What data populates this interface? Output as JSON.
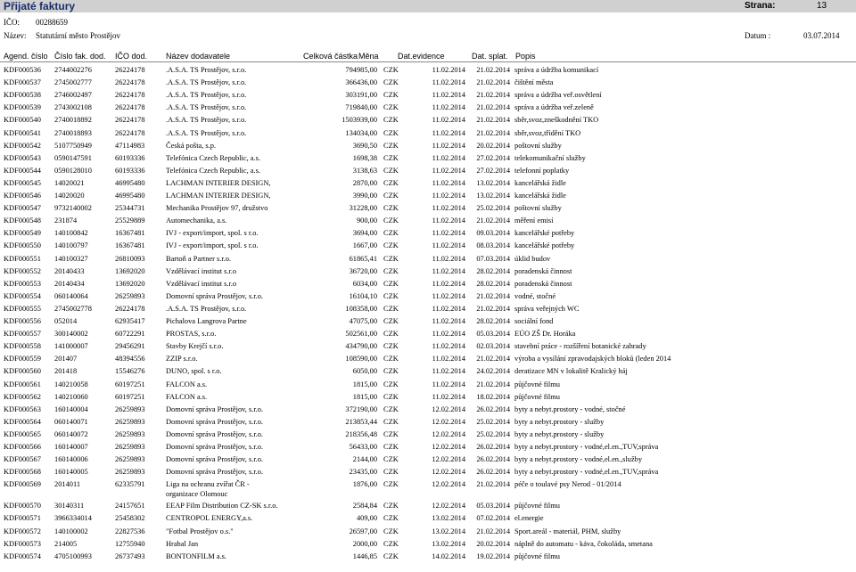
{
  "header": {
    "title": "Přijaté faktury",
    "strana_label": "Strana:",
    "strana_value": "13"
  },
  "meta": {
    "ico_label": "IČO:",
    "ico_value": "00288659",
    "nazev_label": "Název:",
    "nazev_value": "Statutární město Prostějov",
    "datum_label": "Datum :",
    "datum_value": "03.07.2014"
  },
  "columns": {
    "agenda": "Agend. číslo",
    "cislo": "Číslo fak. dod.",
    "ico": "IČO dod.",
    "nazev": "Název dodavatele",
    "castka": "Celková částka",
    "mena": "Měna",
    "evid": "Dat.evidence",
    "splat": "Dat. splat.",
    "popis": "Popis"
  },
  "rows": [
    {
      "agenda": "KDF000536",
      "cislo": "2744002276",
      "ico": "26224178",
      "nazev": ".A.S.A. TS Prostějov, s.r.o.",
      "castka": "794985,00",
      "mena": "CZK",
      "evid": "11.02.2014",
      "splat": "21.02.2014",
      "popis": "správa a údržba komunikací"
    },
    {
      "agenda": "KDF000537",
      "cislo": "2745002777",
      "ico": "26224178",
      "nazev": ".A.S.A. TS Prostějov, s.r.o.",
      "castka": "366436,00",
      "mena": "CZK",
      "evid": "11.02.2014",
      "splat": "21.02.2014",
      "popis": "čištění města"
    },
    {
      "agenda": "KDF000538",
      "cislo": "2746002497",
      "ico": "26224178",
      "nazev": ".A.S.A. TS Prostějov, s.r.o.",
      "castka": "303191,00",
      "mena": "CZK",
      "evid": "11.02.2014",
      "splat": "21.02.2014",
      "popis": "správa a údržba veř.osvětlení"
    },
    {
      "agenda": "KDF000539",
      "cislo": "2743002108",
      "ico": "26224178",
      "nazev": ".A.S.A. TS Prostějov, s.r.o.",
      "castka": "719840,00",
      "mena": "CZK",
      "evid": "11.02.2014",
      "splat": "21.02.2014",
      "popis": "správa a údržba veř.zeleně"
    },
    {
      "agenda": "KDF000540",
      "cislo": "2740018892",
      "ico": "26224178",
      "nazev": ".A.S.A. TS Prostějov, s.r.o.",
      "castka": "1503939,00",
      "mena": "CZK",
      "evid": "11.02.2014",
      "splat": "21.02.2014",
      "popis": "sběr,svoz,zneškodnění TKO"
    },
    {
      "agenda": "KDF000541",
      "cislo": "2740018893",
      "ico": "26224178",
      "nazev": ".A.S.A. TS Prostějov, s.r.o.",
      "castka": "134034,00",
      "mena": "CZK",
      "evid": "11.02.2014",
      "splat": "21.02.2014",
      "popis": "sběr,svoz,třídění TKO"
    },
    {
      "agenda": "KDF000542",
      "cislo": "5107750949",
      "ico": "47114983",
      "nazev": "Česká pošta, s.p.",
      "castka": "3690,50",
      "mena": "CZK",
      "evid": "11.02.2014",
      "splat": "20.02.2014",
      "popis": "poštovní služby"
    },
    {
      "agenda": "KDF000543",
      "cislo": "0590147591",
      "ico": "60193336",
      "nazev": "Telefónica Czech Republic, a.s.",
      "castka": "1698,38",
      "mena": "CZK",
      "evid": "11.02.2014",
      "splat": "27.02.2014",
      "popis": "telekomunikační služby"
    },
    {
      "agenda": "KDF000544",
      "cislo": "0590128010",
      "ico": "60193336",
      "nazev": "Telefónica Czech Republic, a.s.",
      "castka": "3138,63",
      "mena": "CZK",
      "evid": "11.02.2014",
      "splat": "27.02.2014",
      "popis": "telefonní poplatky"
    },
    {
      "agenda": "KDF000545",
      "cislo": "14020021",
      "ico": "46995480",
      "nazev": "LACHMAN INTERIER DESIGN,",
      "castka": "2870,00",
      "mena": "CZK",
      "evid": "11.02.2014",
      "splat": "13.02.2014",
      "popis": "kancelářská židle"
    },
    {
      "agenda": "KDF000546",
      "cislo": "14020020",
      "ico": "46995480",
      "nazev": "LACHMAN INTERIER DESIGN,",
      "castka": "3990,00",
      "mena": "CZK",
      "evid": "11.02.2014",
      "splat": "13.02.2014",
      "popis": "kancelářská židle"
    },
    {
      "agenda": "KDF000547",
      "cislo": "9732140002",
      "ico": "25344731",
      "nazev": "Mechanika Prostějov 97, družstvo",
      "castka": "31228,00",
      "mena": "CZK",
      "evid": "11.02.2014",
      "splat": "25.02.2014",
      "popis": "poštovní služby"
    },
    {
      "agenda": "KDF000548",
      "cislo": "231874",
      "ico": "25529889",
      "nazev": "Automechanika, a.s.",
      "castka": "900,00",
      "mena": "CZK",
      "evid": "11.02.2014",
      "splat": "21.02.2014",
      "popis": "měření emisí"
    },
    {
      "agenda": "KDF000549",
      "cislo": "140100842",
      "ico": "16367481",
      "nazev": "IVJ - export/import, spol. s r.o.",
      "castka": "3694,00",
      "mena": "CZK",
      "evid": "11.02.2014",
      "splat": "09.03.2014",
      "popis": "kancelářské potřeby"
    },
    {
      "agenda": "KDF000550",
      "cislo": "140100797",
      "ico": "16367481",
      "nazev": "IVJ - export/import, spol. s r.o.",
      "castka": "1667,00",
      "mena": "CZK",
      "evid": "11.02.2014",
      "splat": "08.03.2014",
      "popis": "kancelářské potřeby"
    },
    {
      "agenda": "KDF000551",
      "cislo": "140100327",
      "ico": "26810093",
      "nazev": "Bartoň a Partner s.r.o.",
      "castka": "61865,41",
      "mena": "CZK",
      "evid": "11.02.2014",
      "splat": "07.03.2014",
      "popis": "úklid budov"
    },
    {
      "agenda": "KDF000552",
      "cislo": "20140433",
      "ico": "13692020",
      "nazev": "Vzdělávací institut s.r.o",
      "castka": "36720,00",
      "mena": "CZK",
      "evid": "11.02.2014",
      "splat": "28.02.2014",
      "popis": "poradenská činnost"
    },
    {
      "agenda": "KDF000553",
      "cislo": "20140434",
      "ico": "13692020",
      "nazev": "Vzdělávací institut s.r.o",
      "castka": "6034,00",
      "mena": "CZK",
      "evid": "11.02.2014",
      "splat": "28.02.2014",
      "popis": "poradenská činnost"
    },
    {
      "agenda": "KDF000554",
      "cislo": "060140064",
      "ico": "26259893",
      "nazev": "Domovní správa Prostějov, s.r.o.",
      "castka": "16104,10",
      "mena": "CZK",
      "evid": "11.02.2014",
      "splat": "21.02.2014",
      "popis": "vodné, stočné"
    },
    {
      "agenda": "KDF000555",
      "cislo": "2745002778",
      "ico": "26224178",
      "nazev": ".A.S.A. TS Prostějov, s.r.o.",
      "castka": "108358,00",
      "mena": "CZK",
      "evid": "11.02.2014",
      "splat": "21.02.2014",
      "popis": "správa veřejných WC"
    },
    {
      "agenda": "KDF000556",
      "cislo": "052014",
      "ico": "62935417",
      "nazev": "Pichalova Langrova Partne",
      "castka": "47075,00",
      "mena": "CZK",
      "evid": "11.02.2014",
      "splat": "28.02.2014",
      "popis": "sociální fond"
    },
    {
      "agenda": "KDF000557",
      "cislo": "300140002",
      "ico": "60722291",
      "nazev": "PROSTAS, s.r.o.",
      "castka": "502561,00",
      "mena": "CZK",
      "evid": "11.02.2014",
      "splat": "05.03.2014",
      "popis": "EÚO ZŠ Dr. Horáka"
    },
    {
      "agenda": "KDF000558",
      "cislo": "141000007",
      "ico": "29456291",
      "nazev": "Stavby Krejčí s.r.o.",
      "castka": "434790,00",
      "mena": "CZK",
      "evid": "11.02.2014",
      "splat": "02.03.2014",
      "popis": "stavební práce - rozšíření botanické zahrady"
    },
    {
      "agenda": "KDF000559",
      "cislo": "201407",
      "ico": "48394556",
      "nazev": "ZZIP s.r.o.",
      "castka": "108590,00",
      "mena": "CZK",
      "evid": "11.02.2014",
      "splat": "21.02.2014",
      "popis": "výroba a vysílání zpravodajských bloků (leden 2014"
    },
    {
      "agenda": "KDF000560",
      "cislo": "201418",
      "ico": "15546276",
      "nazev": "DUNO, spol. s r.o.",
      "castka": "6050,00",
      "mena": "CZK",
      "evid": "11.02.2014",
      "splat": "24.02.2014",
      "popis": "deratizace MN v lokalitě Kralický háj"
    },
    {
      "agenda": "KDF000561",
      "cislo": "140210058",
      "ico": "60197251",
      "nazev": "FALCON a.s.",
      "castka": "1815,00",
      "mena": "CZK",
      "evid": "11.02.2014",
      "splat": "21.02.2014",
      "popis": "půjčovné filmu"
    },
    {
      "agenda": "KDF000562",
      "cislo": "140210060",
      "ico": "60197251",
      "nazev": "FALCON a.s.",
      "castka": "1815,00",
      "mena": "CZK",
      "evid": "11.02.2014",
      "splat": "18.02.2014",
      "popis": "půjčovné filmu"
    },
    {
      "agenda": "KDF000563",
      "cislo": "160140004",
      "ico": "26259893",
      "nazev": "Domovní správa Prostějov, s.r.o.",
      "castka": "372190,00",
      "mena": "CZK",
      "evid": "12.02.2014",
      "splat": "26.02.2014",
      "popis": "byty a nebyt.prostory - vodné, stočné"
    },
    {
      "agenda": "KDF000564",
      "cislo": "060140071",
      "ico": "26259893",
      "nazev": "Domovní správa Prostějov, s.r.o.",
      "castka": "213853,44",
      "mena": "CZK",
      "evid": "12.02.2014",
      "splat": "25.02.2014",
      "popis": "byty a nebyt.prostory - služby"
    },
    {
      "agenda": "KDF000565",
      "cislo": "060140072",
      "ico": "26259893",
      "nazev": "Domovní správa Prostějov, s.r.o.",
      "castka": "218356,48",
      "mena": "CZK",
      "evid": "12.02.2014",
      "splat": "25.02.2014",
      "popis": "byty a nebyt.prostory - služby"
    },
    {
      "agenda": "KDF000566",
      "cislo": "160140007",
      "ico": "26259893",
      "nazev": "Domovní správa Prostějov, s.r.o.",
      "castka": "56433,00",
      "mena": "CZK",
      "evid": "12.02.2014",
      "splat": "26.02.2014",
      "popis": "byty a nebyt.prostory - vodné,el.en.,TUV,správa"
    },
    {
      "agenda": "KDF000567",
      "cislo": "160140006",
      "ico": "26259893",
      "nazev": "Domovní správa Prostějov, s.r.o.",
      "castka": "2144,00",
      "mena": "CZK",
      "evid": "12.02.2014",
      "splat": "26.02.2014",
      "popis": "byty a nebyt.prostory - vodné,el.en.,služby"
    },
    {
      "agenda": "KDF000568",
      "cislo": "160140005",
      "ico": "26259893",
      "nazev": "Domovní správa Prostějov, s.r.o.",
      "castka": "23435,00",
      "mena": "CZK",
      "evid": "12.02.2014",
      "splat": "26.02.2014",
      "popis": "byty a nebyt.prostory - vodné,el.en.,TUV,správa"
    },
    {
      "agenda": "KDF000569",
      "cislo": "2014011",
      "ico": "62335791",
      "nazev": "Liga na ochranu zvířat ČR - organizace Olomouc",
      "castka": "1876,00",
      "mena": "CZK",
      "evid": "12.02.2014",
      "splat": "21.02.2014",
      "popis": "péče o toulavé psy Nerod - 01/2014"
    },
    {
      "agenda": "KDF000570",
      "cislo": "30140311",
      "ico": "24157651",
      "nazev": "EEAP Film Distribution CZ-SK s.r.o.",
      "castka": "2584,84",
      "mena": "CZK",
      "evid": "12.02.2014",
      "splat": "05.03.2014",
      "popis": "půjčovné filmu"
    },
    {
      "agenda": "KDF000571",
      "cislo": "3966334014",
      "ico": "25458302",
      "nazev": "CENTROPOL ENERGY,a.s.",
      "castka": "409,00",
      "mena": "CZK",
      "evid": "13.02.2014",
      "splat": "07.02.2014",
      "popis": "el.energie"
    },
    {
      "agenda": "KDF000572",
      "cislo": "140100002",
      "ico": "22827536",
      "nazev": "\"Fotbal Prostějov o.s.\"",
      "castka": "26597,00",
      "mena": "CZK",
      "evid": "13.02.2014",
      "splat": "21.02.2014",
      "popis": "Sport.areál - materiál, PHM, služby"
    },
    {
      "agenda": "KDF000573",
      "cislo": "214005",
      "ico": "12755940",
      "nazev": "Hrabal Jan",
      "castka": "2000,00",
      "mena": "CZK",
      "evid": "13.02.2014",
      "splat": "20.02.2014",
      "popis": "náplně do automatu - káva, čokoláda, smetana"
    },
    {
      "agenda": "KDF000574",
      "cislo": "4705100993",
      "ico": "26737493",
      "nazev": "BONTONFILM a.s.",
      "castka": "1446,85",
      "mena": "CZK",
      "evid": "14.02.2014",
      "splat": "19.02.2014",
      "popis": "půjčovné filmu"
    }
  ]
}
